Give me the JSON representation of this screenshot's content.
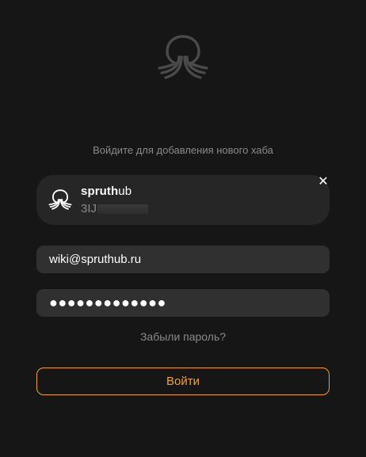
{
  "logo": {
    "icon": "octopus-logo-icon"
  },
  "subtitle": "Войдите для добавления нового хаба",
  "hub": {
    "name_bold": "spruth",
    "name_light": "ub",
    "id_prefix": "3IJ",
    "icon": "octopus-icon",
    "close_label": "✕"
  },
  "email": {
    "value": "wiki@spruthub.ru"
  },
  "password": {
    "masked_value": "●●●●●●●●●●●●●"
  },
  "forgot_label": "Забыли пароль?",
  "login_label": "Войти",
  "colors": {
    "background": "#161616",
    "card": "#262626",
    "field": "#303030",
    "accent": "#f0a22a",
    "muted_text": "#8a8a8a"
  }
}
